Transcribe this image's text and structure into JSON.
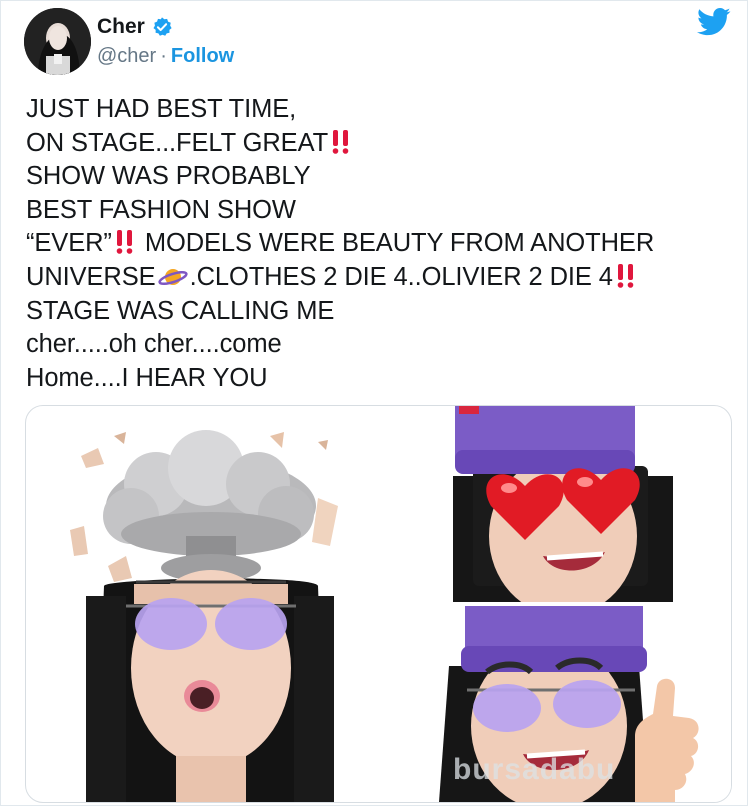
{
  "user": {
    "name": "Cher",
    "handle": "@cher",
    "separator": "·",
    "follow_label": "Follow"
  },
  "tweet": {
    "lines": [
      {
        "pre": "JUST HAD BEST TIME,",
        "post": ""
      },
      {
        "pre": "ON STAGE...FELT GREAT",
        "post": ""
      },
      {
        "pre": "SHOW WAS PROBABLY",
        "post": ""
      },
      {
        "pre": "BEST FASHION SHOW",
        "post": ""
      },
      {
        "pre": "“EVER”",
        "post": " MODELS WERE BEAUTY FROM ANOTHER"
      },
      {
        "pre": "UNIVERSE",
        "post": ".CLOTHES 2 DIE 4..OLIVIER 2 DIE 4"
      },
      {
        "pre": "STAGE WAS CALLING ME",
        "post": ""
      },
      {
        "pre": "cher.....oh cher....come",
        "post": ""
      },
      {
        "pre": "Home....I HEAR YOU",
        "post": ""
      }
    ]
  },
  "watermark": "bursadabu",
  "colors": {
    "link": "#1b95e0",
    "text": "#14171a",
    "muted": "#657786",
    "emoji_red": "#e0173d",
    "hat_purple": "#7b5cc6"
  },
  "icons": [
    "verified-icon",
    "twitter-bird-icon",
    "double-exclamation-icon",
    "ringed-planet-icon"
  ],
  "media_description_labels": []
}
